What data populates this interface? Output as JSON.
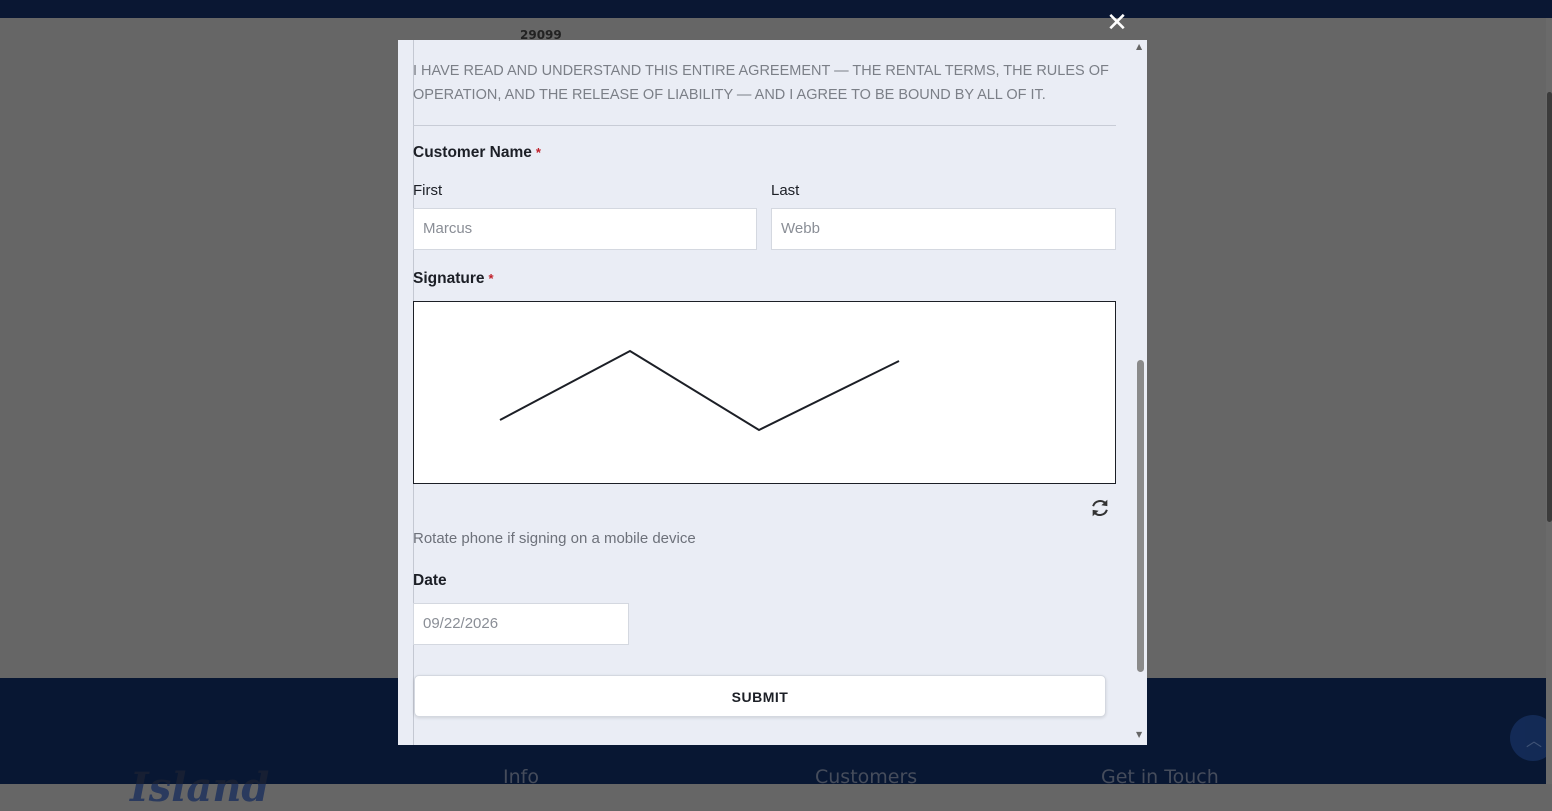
{
  "background": {
    "number": "29099",
    "footer_logo_text": "Island",
    "footer_cols": [
      "Info",
      "Customers",
      "Get in Touch"
    ]
  },
  "modal": {
    "agreement_text": "I HAVE READ AND UNDERSTAND THIS ENTIRE AGREEMENT — THE RENTAL TERMS, THE RULES OF OPERATION, AND THE RELEASE OF LIABILITY — AND I AGREE TO BE BOUND BY ALL OF IT.",
    "customer_name_label": "Customer Name",
    "required_mark": "*",
    "first_label": "First",
    "last_label": "Last",
    "first_value": "Marcus",
    "last_value": "Webb",
    "signature_label": "Signature",
    "rotate_hint": "Rotate phone if signing on a mobile device",
    "date_label": "Date",
    "date_value": "09/22/2026",
    "submit_label": "SUBMIT",
    "close_glyph": "✕"
  },
  "icons": {
    "close": "close-icon",
    "refresh": "refresh-icon",
    "scroll_up": "chevron-up-icon",
    "scroll_down": "chevron-down-icon"
  },
  "colors": {
    "modal_bg": "#eaedf5",
    "footer_bg": "#0f2a5e",
    "required": "#c0202a"
  }
}
